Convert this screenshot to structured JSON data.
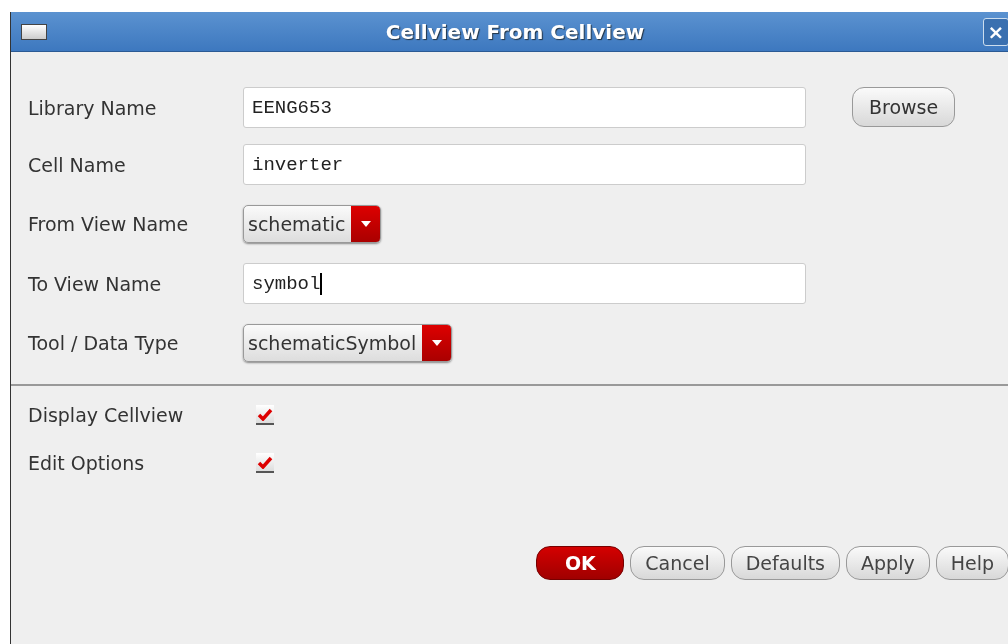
{
  "window": {
    "title": "Cellview From Cellview",
    "close_button": "×"
  },
  "fields": [
    {
      "kind": "text",
      "label": "Library Name",
      "value": "EENG653"
    },
    {
      "kind": "text",
      "label": "Cell Name",
      "value": "inverter"
    },
    {
      "kind": "dropdown",
      "label": "From View Name",
      "value": "schematic"
    },
    {
      "kind": "text",
      "label": "To View Name",
      "value": "symbol",
      "focused": true
    },
    {
      "kind": "dropdown",
      "label": "Tool / Data Type",
      "value": "schematicSymbol"
    }
  ],
  "browse_button": "Browse",
  "options": [
    {
      "label": "Display Cellview",
      "checked": true
    },
    {
      "label": "Edit Options",
      "checked": true
    }
  ],
  "buttons": [
    {
      "label": "OK",
      "kind": "primary"
    },
    {
      "label": "Cancel",
      "kind": "normal"
    },
    {
      "label": "Defaults",
      "kind": "normal"
    },
    {
      "label": "Apply",
      "kind": "normal"
    },
    {
      "label": "Help",
      "kind": "normal"
    }
  ]
}
